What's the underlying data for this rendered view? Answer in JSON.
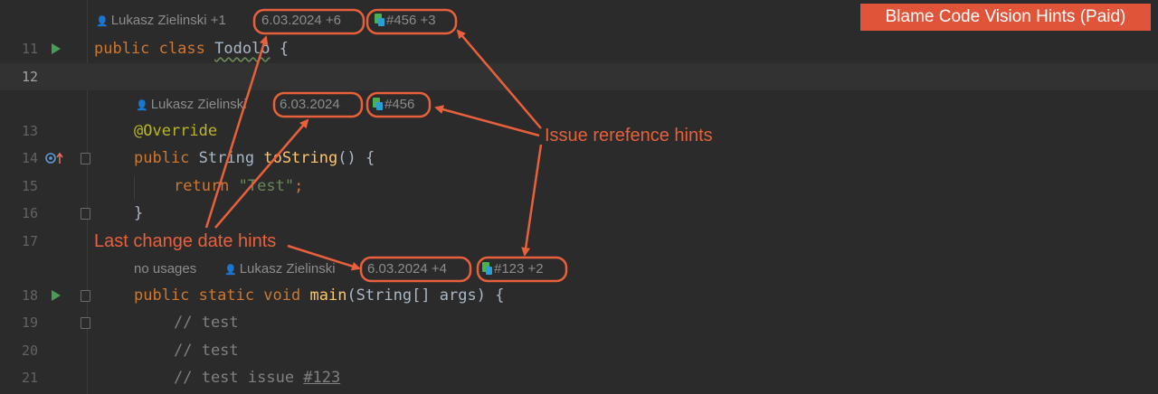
{
  "banner": {
    "title": "Blame Code Vision Hints (Paid)"
  },
  "hints": {
    "class_author": "Lukasz Zielinski +1",
    "class_date": "6.03.2024 +6",
    "class_issue": "#456 +3",
    "method_author": "Lukasz Zielinski",
    "method_date": "6.03.2024",
    "method_issue": "#456",
    "main_usages": "no usages",
    "main_author": "Lukasz Zielinski",
    "main_date": "6.03.2024 +4",
    "main_issue": "#123 +2"
  },
  "line_numbers": [
    "11",
    "12",
    "13",
    "14",
    "15",
    "16",
    "17",
    "18",
    "19",
    "20",
    "21"
  ],
  "code": {
    "l11_kw1": "public",
    "l11_kw2": "class",
    "l11_name": "Todolo",
    "l11_brace": "{",
    "l13_annotation": "@Override",
    "l14_kw": "public",
    "l14_type": "String",
    "l14_fn": "toString",
    "l14_rest": "() {",
    "l15_kw": "return",
    "l15_str": "\"Test\"",
    "l15_semi": ";",
    "l16": "}",
    "l18_kw": "public static void",
    "l18_fn": "main",
    "l18_rest": "(String[] args) {",
    "l19": "// test",
    "l20": "// test",
    "l21_prefix": "// test issue ",
    "l21_link": "#123"
  },
  "callouts": {
    "issue": "Issue rerefence hints",
    "date": "Last change date hints"
  },
  "colors": {
    "callout": "#e8603c",
    "keyword": "#cc7832",
    "function": "#ffc66d",
    "string": "#6a8759"
  }
}
